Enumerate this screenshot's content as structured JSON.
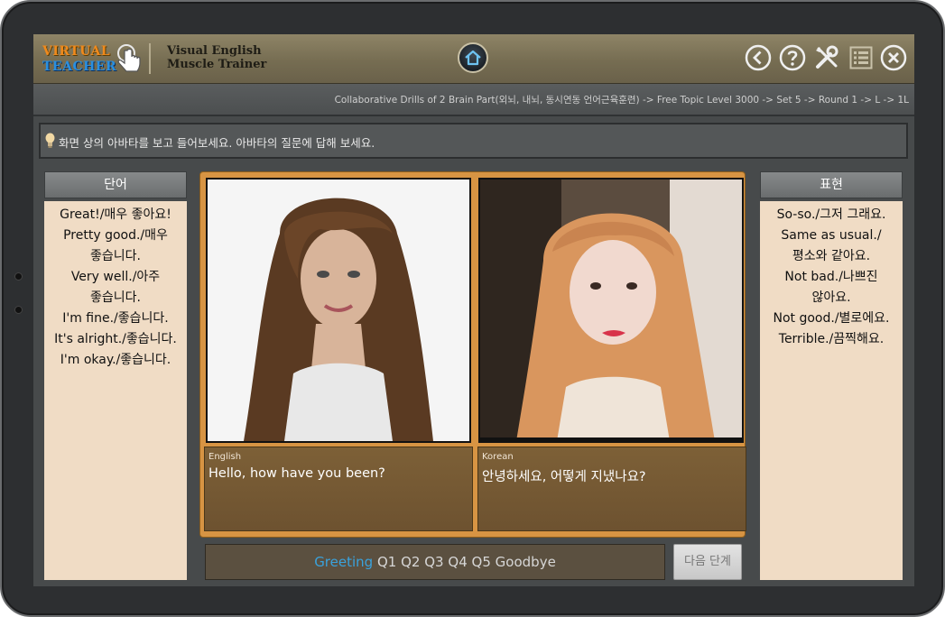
{
  "header": {
    "logo_line1": "VIRTUAL",
    "logo_line2": "TEACHER",
    "title_line1": "Visual English",
    "title_line2": "Muscle Trainer",
    "icons": [
      "home-icon",
      "back-icon",
      "help-icon",
      "tools-icon",
      "list-icon",
      "close-icon"
    ]
  },
  "breadcrumb": "Collaborative Drills of 2 Brain Part(외뇌, 내뇌, 동시연동 언어근육훈련) -> Free Topic Level 3000 -> Set 5 ->  Round 1 -> L -> 1L",
  "instruction": "화면 상의 아바타를 보고 들어보세요. 아바타의 질문에 답해 보세요.",
  "left_panel": {
    "heading": "단어",
    "items": [
      "Great!/매우 좋아요!",
      "Pretty good./매우",
      "좋습니다.",
      "Very well./아주",
      "좋습니다.",
      "I'm fine./좋습니다.",
      "It's alright./좋습니다.",
      "I'm okay./좋습니다."
    ]
  },
  "right_panel": {
    "heading": "표현",
    "items": [
      "So-so./그저 그래요.",
      "Same as usual./",
      "평소와 같아요.",
      "Not bad./나쁘진",
      "않아요.",
      "Not good./별로에요.",
      "Terrible./끔찍해요."
    ]
  },
  "captions": {
    "english": {
      "lang": "English",
      "text": "Hello, how have you been?"
    },
    "korean": {
      "lang": "Korean",
      "text": "안녕하세요, 어떻게 지냈나요?"
    }
  },
  "progress": {
    "active": "Greeting",
    "steps": [
      "Q1",
      "Q2",
      "Q3",
      "Q4",
      "Q5",
      "Goodbye"
    ]
  },
  "next_button": "다음 단계",
  "colors": {
    "accent_blue": "#3aa2dc",
    "side_panel_bg": "#f0dcc5",
    "stage_frame": "#d79443",
    "caption_bg": "#7d6037"
  }
}
